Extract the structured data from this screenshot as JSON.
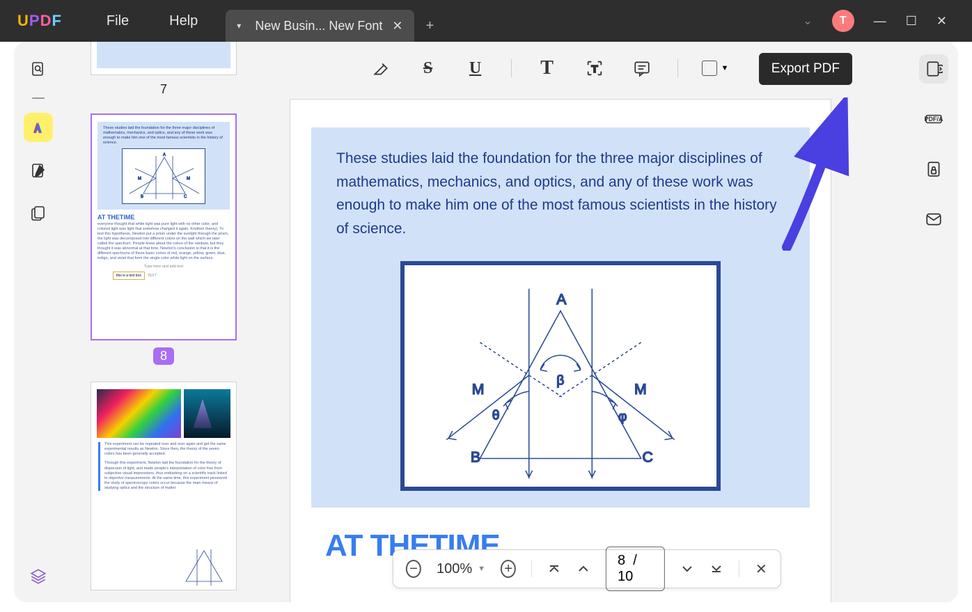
{
  "logoLetters": [
    "U",
    "P",
    "D",
    "F"
  ],
  "menu": {
    "file": "File",
    "help": "Help"
  },
  "tab": {
    "title": "New Busin... New Font",
    "closeGlyph": "✕"
  },
  "newTabGlyph": "+",
  "winControls": {
    "caret": "⌄",
    "avatar": "T",
    "minimize": "—",
    "maximize": "☐",
    "close": "✕"
  },
  "tooltip": "Export PDF",
  "rightRail": {
    "pdfa": "PDF/A"
  },
  "zoombar": {
    "level": "100%",
    "pageCurrent": "8",
    "pageSep": "/",
    "pageTotal": "10"
  },
  "thumbs": {
    "p7": "7",
    "p8": "8"
  },
  "document": {
    "paragraph": "These studies laid the foundation for the three major disciplines of mathematics, mechanics, and optics, and any of these work was enough to make him one of the most famous scientists in the history of science.",
    "heading": "AT THETIME",
    "diagramLabels": {
      "A": "A",
      "B": "B",
      "C": "C",
      "M1": "M",
      "M2": "M",
      "beta": "β",
      "theta": "θ",
      "phi": "φ"
    }
  },
  "thumb8": {
    "intro": "These studies laid the foundation for the three major disciplines of mathematics, mechanics, and optics, and any of these work was enough to make him one of the most famous scientists in the history of science.",
    "heading": "AT THETIME",
    "para": "everyone thought that white light was pure light with no other color, and colored light was light that somehow changed it again. Kristhen theory). To test this hypothesis, Newton put a prism under the sunlight through the prism, the light was decomposed into different colors on the wall which we later called the spectrum. People knew about the colors of the rainbow, but they thought it was abnormal at that time. Newton's conclusion is that it is the different spectrums of these basic colors of red, orange, yellow, green, blue, indigo, and violet that form the single color white light on the surface.",
    "textprompt": "Type here and add text",
    "btn": "this is a text box",
    "btnLbl": "TEXT"
  },
  "thumb9": {
    "para1": "This experiment can be repeated over and over again and get the same experimental results as Newton. Since then, the theory of the seven colors has been generally accepted.",
    "para2": "Through this experiment, Newton laid the foundation for the theory of dispersion of light, and made people's interpretation of color free from subjective visual impressions, thus embarking on a scientific track linked to objective measurements. At the same time, this experiment pioneered the study of spectroscopy colors occur because the main means of studying optics and the structure of matter."
  }
}
